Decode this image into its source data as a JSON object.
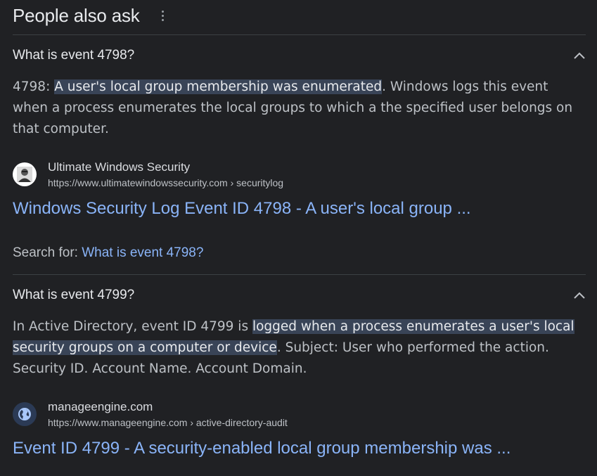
{
  "header": {
    "title": "People also ask",
    "menu_icon": "kebab-menu-icon"
  },
  "items": [
    {
      "question": "What is event 4798?",
      "expanded": true,
      "answer_prefix": "4798: ",
      "answer_highlight": "A user's local group membership was enumerated",
      "answer_suffix": ". Windows logs this event when a process enumerates the local groups to which a the specified user belongs on that computer.",
      "source_name": "Ultimate Windows Security",
      "source_url": "https://www.ultimatewindowssecurity.com › securitylog",
      "link_title": "Windows Security Log Event ID 4798 - A user's local group ...",
      "search_for_label": "Search for: ",
      "search_for_query": "What is event 4798?"
    },
    {
      "question": "What is event 4799?",
      "expanded": true,
      "answer_prefix": "In Active Directory, event ID 4799 is ",
      "answer_highlight": "logged when a process enumerates a user's local security groups on a computer or device",
      "answer_suffix": ". Subject: User who performed the action. Security ID. Account Name. Account Domain.",
      "source_name": "manageengine.com",
      "source_url": "https://www.manageengine.com › active-directory-audit",
      "link_title": "Event ID 4799 - A security-enabled local group membership was ..."
    }
  ],
  "colors": {
    "background": "#202124",
    "link": "#8ab4f8",
    "highlight": "#394457",
    "divider": "#3c4043"
  }
}
